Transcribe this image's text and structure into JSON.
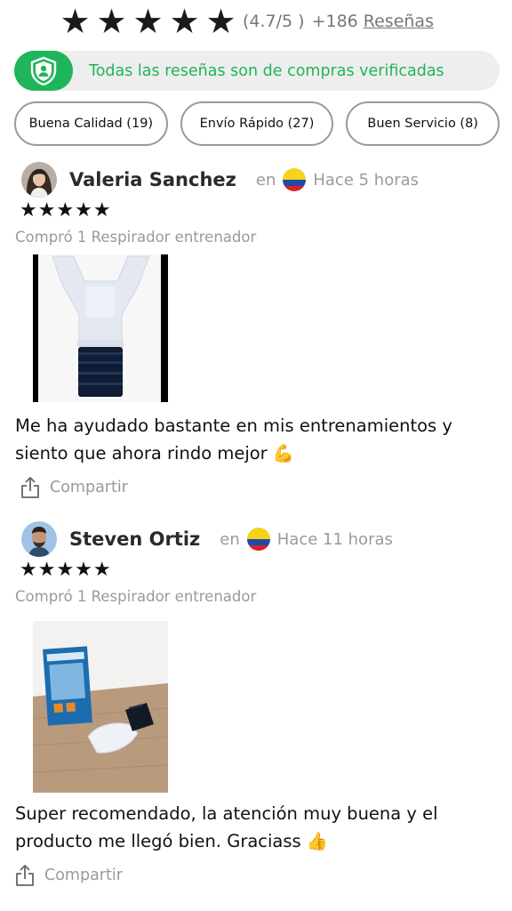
{
  "rating": {
    "stars": [
      "★",
      "★",
      "★",
      "★",
      "★"
    ],
    "value": "(4.7/5 )",
    "count": "+186",
    "link": "Reseñas"
  },
  "verified": {
    "icon": "shield-user-icon",
    "text": "Todas las reseñas son de compras verificadas",
    "accent": "#1fb55a"
  },
  "filters": [
    {
      "label": "Buena Calidad (19)"
    },
    {
      "label": "Envío Rápido (27)"
    },
    {
      "label": "Buen Servicio (8)"
    }
  ],
  "reviews": [
    {
      "name": "Valeria Sanchez",
      "prefix": "en",
      "country_flag": "colombia-flag-icon",
      "time": "Hace 5 horas",
      "stars": "★★★★★",
      "product": "Compró 1 Respirador entrenador",
      "text": "Me ha ayudado bastante en mis entrenamientos y siento que ahora rindo mejor 💪",
      "share": "Compartir"
    },
    {
      "name": "Steven Ortiz",
      "prefix": "en",
      "country_flag": "colombia-flag-icon",
      "time": "Hace 11 horas",
      "stars": "★★★★★",
      "product": "Compró 1 Respirador entrenador",
      "text": "Super recomendado, la atención muy buena y el producto me llegó bien. Graciass 👍",
      "share": "Compartir"
    }
  ]
}
